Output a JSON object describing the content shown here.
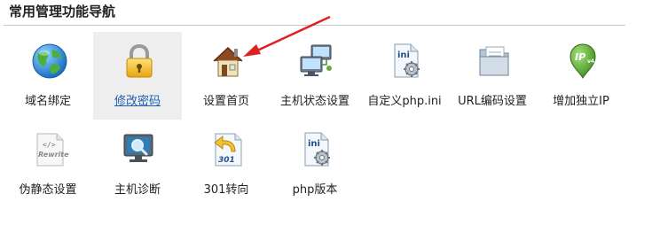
{
  "section": {
    "title": "常用管理功能导航"
  },
  "nav_items": [
    {
      "label": "域名绑定",
      "icon": "globe-icon",
      "active": false
    },
    {
      "label": "修改密码",
      "icon": "padlock-icon",
      "active": true
    },
    {
      "label": "设置首页",
      "icon": "home-icon",
      "active": false
    },
    {
      "label": "主机状态设置",
      "icon": "network-computers-icon",
      "active": false
    },
    {
      "label": "自定义php.ini",
      "icon": "ini-file-gear-icon",
      "active": false
    },
    {
      "label": "URL编码设置",
      "icon": "folder-document-icon",
      "active": false
    },
    {
      "label": "增加独立IP",
      "icon": "ipv4-location-pin-icon",
      "active": false
    },
    {
      "label": "伪静态设置",
      "icon": "rewrite-code-file-icon",
      "active": false
    },
    {
      "label": "主机诊断",
      "icon": "monitor-magnifier-icon",
      "active": false
    },
    {
      "label": "301转向",
      "icon": "redirect-301-arrow-icon",
      "active": false
    },
    {
      "label": "php版本",
      "icon": "ini-file-gear-icon",
      "active": false
    }
  ],
  "colors": {
    "active_label": "#1f5fb5",
    "active_background": "#eeeeee",
    "annotation_arrow": "#e02020"
  }
}
